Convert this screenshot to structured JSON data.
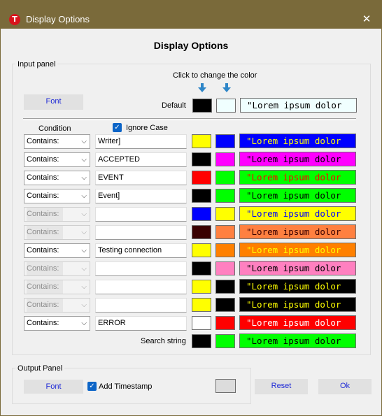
{
  "window": {
    "title": "Display Options",
    "app_icon_letter": "T",
    "close_glyph": "✕"
  },
  "heading": "Display Options",
  "input_panel": {
    "label": "Input panel",
    "hint": "Click to change the color",
    "font_button": "Font",
    "default_label": "Default",
    "default_fg": "#000000",
    "default_bg": "#f0ffff",
    "preview_text": "\"Lorem ipsum dolor",
    "condition_header": "Condition",
    "ignore_case_label": "Ignore Case",
    "ignore_case_checked": true,
    "rows": [
      {
        "condition": "Contains:",
        "enabled": true,
        "text": "Writer]",
        "fg": "#ffff00",
        "bg": "#0000ff"
      },
      {
        "condition": "Contains:",
        "enabled": true,
        "text": "ACCEPTED",
        "fg": "#000000",
        "bg": "#ff00ff"
      },
      {
        "condition": "Contains:",
        "enabled": true,
        "text": "EVENT",
        "fg": "#ff0000",
        "bg": "#00ff00"
      },
      {
        "condition": "Contains:",
        "enabled": true,
        "text": " Event]",
        "fg": "#000000",
        "bg": "#00ff00"
      },
      {
        "condition": "Contains:",
        "enabled": false,
        "text": "",
        "fg": "#0000ff",
        "bg": "#ffff00"
      },
      {
        "condition": "Contains:",
        "enabled": false,
        "text": "",
        "fg": "#3a0000",
        "bg": "#ff8040"
      },
      {
        "condition": "Contains:",
        "enabled": true,
        "text": "Testing connection",
        "fg": "#ffff00",
        "bg": "#ff8000"
      },
      {
        "condition": "Contains:",
        "enabled": false,
        "text": "",
        "fg": "#000000",
        "bg": "#ff80c0"
      },
      {
        "condition": "Contains:",
        "enabled": false,
        "text": "",
        "fg": "#ffff00",
        "bg": "#000000"
      },
      {
        "condition": "Contains:",
        "enabled": false,
        "text": "",
        "fg": "#ffff00",
        "bg": "#000000"
      },
      {
        "condition": "Contains:",
        "enabled": true,
        "text": "ERROR",
        "fg": "#ffffff",
        "bg": "#ff0000"
      }
    ],
    "search_string_label": "Search string",
    "search_fg": "#000000",
    "search_bg": "#00ff00"
  },
  "output_panel": {
    "label": "Output Panel",
    "font_button": "Font",
    "add_timestamp_label": "Add Timestamp",
    "add_timestamp_checked": true,
    "timestamp_color": "#dcdcdc"
  },
  "buttons": {
    "reset": "Reset",
    "ok": "Ok"
  },
  "colors": {
    "titlebar": "#7a6a3a",
    "accent": "#0b64c7",
    "link_blue": "#1f2ad6",
    "arrow": "#2e86c8"
  },
  "icons": {
    "app": "app-logo-icon",
    "close": "close-icon",
    "arrow": "arrow-down-icon",
    "check": "checkmark-icon",
    "chevron": "chevron-down-icon"
  }
}
